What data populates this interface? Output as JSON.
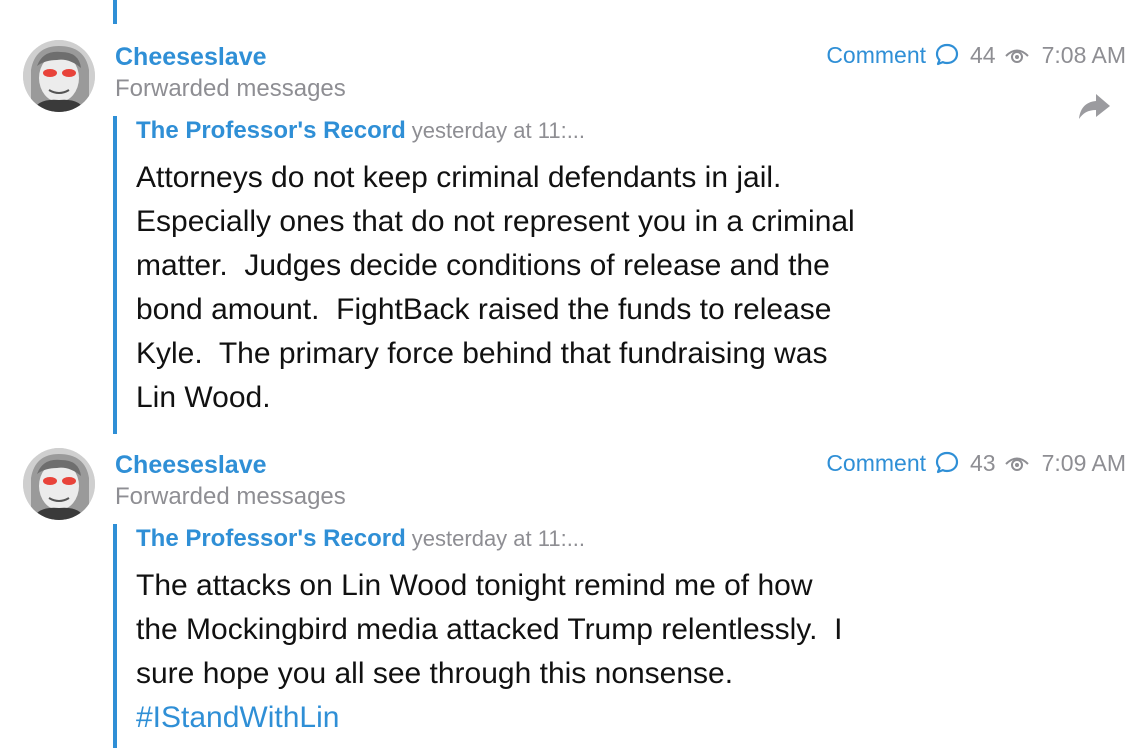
{
  "colors": {
    "accent": "#2f8fd6",
    "muted": "#8e8e93",
    "text": "#111111",
    "background": "#ffffff"
  },
  "messages": [
    {
      "sender": "Cheeseslave",
      "subtitle": "Forwarded messages",
      "comment_label": "Comment",
      "views": "44",
      "time": "7:08 AM",
      "forward": {
        "source": "The Professor's Record",
        "date": "yesterday at 11:...",
        "lines": [
          "Attorneys do not keep criminal defendants in jail.",
          "Especially ones that do not represent you in a criminal",
          "matter.  Judges decide conditions of release and the",
          "bond amount.  FightBack raised the funds to release",
          "Kyle.  The primary force behind that fundraising was",
          "Lin Wood."
        ]
      }
    },
    {
      "sender": "Cheeseslave",
      "subtitle": "Forwarded messages",
      "comment_label": "Comment",
      "views": "43",
      "time": "7:09 AM",
      "forward": {
        "source": "The Professor's Record",
        "date": "yesterday at 11:...",
        "lines": [
          "The attacks on Lin Wood tonight remind me of how",
          "the Mockingbird media attacked Trump relentlessly.  I",
          "sure hope you all see through this nonsense."
        ],
        "hashtag": "#IStandWithLin"
      }
    }
  ],
  "icons": {
    "comment": "comment-bubble-icon",
    "views": "eye-icon",
    "share": "share-arrow-icon"
  }
}
